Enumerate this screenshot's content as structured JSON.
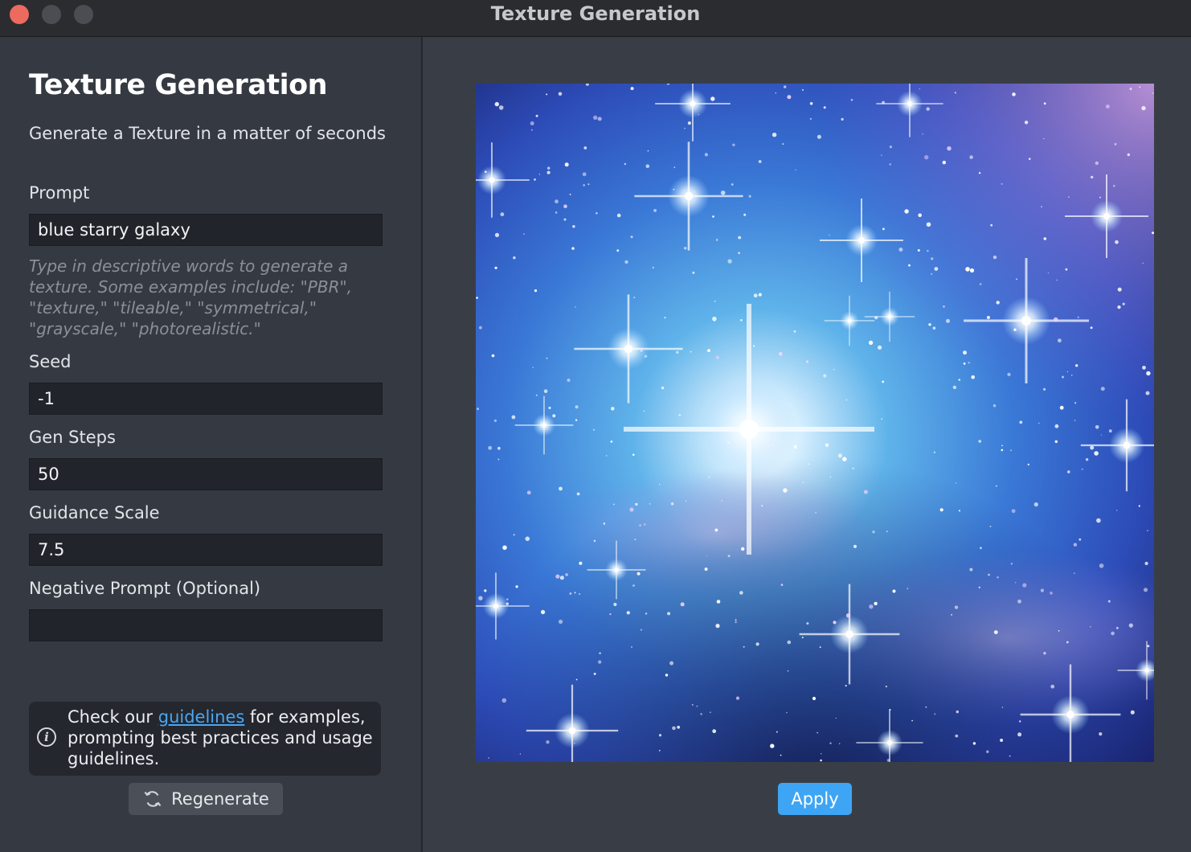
{
  "window": {
    "title": "Texture Generation"
  },
  "panel": {
    "heading": "Texture Generation",
    "subtitle": "Generate a Texture in a matter of seconds",
    "prompt_label": "Prompt",
    "prompt_value": "blue starry galaxy",
    "prompt_hint": "Type in descriptive words to generate a texture. Some examples include: \"PBR\", \"texture,\" \"tileable,\" \"symmetrical,\" \"grayscale,\" \"photorealistic.\"",
    "seed_label": "Seed",
    "seed_value": "-1",
    "gen_steps_label": "Gen Steps",
    "gen_steps_value": "50",
    "guidance_label": "Guidance Scale",
    "guidance_value": "7.5",
    "negative_label": "Negative Prompt (Optional)",
    "negative_value": "",
    "info_prefix": "Check our ",
    "info_link": "guidelines",
    "info_suffix": " for examples, prompting best practices and usage guidelines.",
    "regenerate_label": "Regenerate"
  },
  "preview": {
    "apply_label": "Apply"
  },
  "icons": {
    "info": "info-circle-icon",
    "regenerate": "refresh-icon"
  },
  "colors": {
    "accent": "#3ea5f5",
    "link": "#4aa6f3",
    "close": "#ec6a5e"
  }
}
